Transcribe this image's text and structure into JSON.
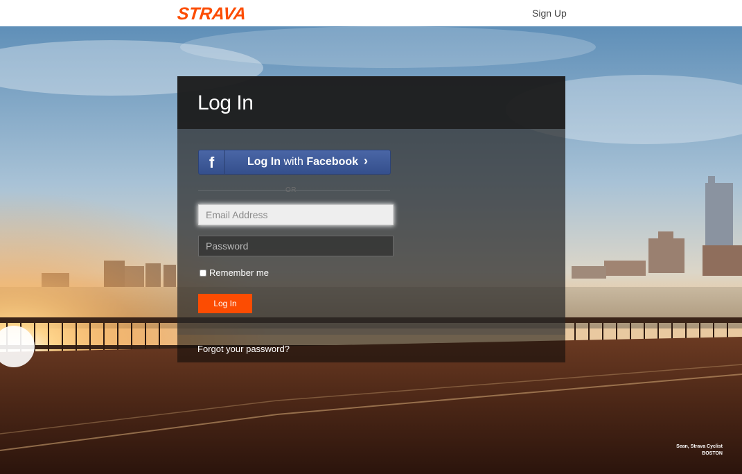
{
  "header": {
    "logo": "STRAVA",
    "signup_label": "Sign Up"
  },
  "login": {
    "title": "Log In",
    "facebook": {
      "icon": "f",
      "prefix": "Log In",
      "with": "with",
      "brand": "Facebook",
      "chevron": "›"
    },
    "or_text": "OR",
    "email_placeholder": "Email Address",
    "password_placeholder": "Password",
    "remember_label": "Remember me",
    "submit_label": "Log In",
    "forgot_label": "Forgot your password?"
  },
  "credit": {
    "line1": "Sean, Strava Cyclist",
    "line2": "BOSTON"
  },
  "colors": {
    "brand": "#fc4c02",
    "facebook": "#3b5998"
  }
}
